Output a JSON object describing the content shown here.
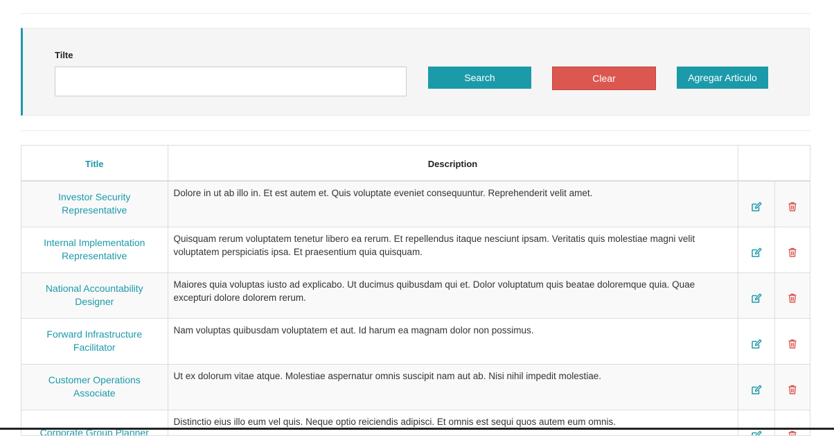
{
  "search_form": {
    "label": "Tilte",
    "input_value": "",
    "buttons": {
      "search": "Search",
      "clear": "Clear",
      "add": "Agregar Articulo"
    }
  },
  "table": {
    "headers": {
      "title": "Title",
      "description": "Description"
    },
    "rows": [
      {
        "title": "Investor Security Representative",
        "description": "Dolore in ut ab illo in. Et est autem et. Quis voluptate eveniet consequuntur. Reprehenderit velit amet."
      },
      {
        "title": "Internal Implementation Representative",
        "description": "Quisquam rerum voluptatem tenetur libero ea rerum. Et repellendus itaque nesciunt ipsam. Veritatis quis molestiae magni velit voluptatem perspiciatis ipsa. Et praesentium quia quisquam."
      },
      {
        "title": "National Accountability Designer",
        "description": "Maiores quia voluptas iusto ad explicabo. Ut ducimus quibusdam qui et. Dolor voluptatum quis beatae doloremque quia. Quae excepturi dolore dolorem rerum."
      },
      {
        "title": "Forward Infrastructure Facilitator",
        "description": "Nam voluptas quibusdam voluptatem et aut. Id harum ea magnam dolor non possimus."
      },
      {
        "title": "Customer Operations Associate",
        "description": "Ut ex dolorum vitae atque. Molestiae aspernatur omnis suscipit nam aut ab. Nisi nihil impedit molestiae."
      },
      {
        "title": "Corporate Group Planner",
        "description": "Distinctio eius illo eum vel quis. Neque optio reiciendis adipisci. Et omnis est sequi quos autem eum omnis."
      }
    ]
  },
  "icons": {
    "edit": "edit-icon",
    "delete": "trash-icon"
  },
  "colors": {
    "accent": "#1b9aaa",
    "danger": "#dc5750"
  }
}
